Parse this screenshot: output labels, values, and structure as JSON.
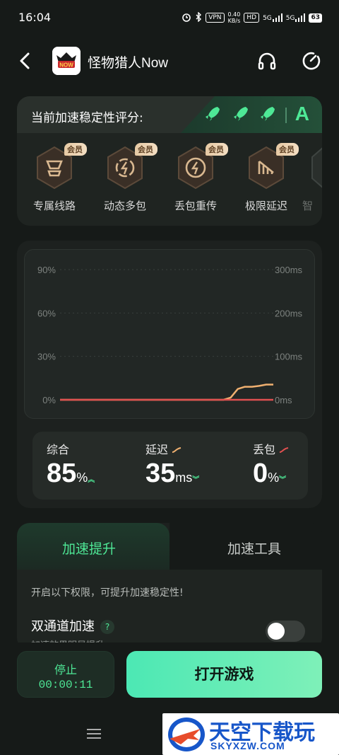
{
  "status_bar": {
    "time": "16:04",
    "vpn": "VPN",
    "speed_top": "0.40",
    "speed_bottom": "KB/s",
    "hd": "HD",
    "net1": "5G",
    "net2": "5G",
    "battery": "63"
  },
  "header": {
    "app_title": "怪物猎人Now",
    "app_icon_text": "NOW"
  },
  "stability": {
    "label": "当前加速稳定性评分:",
    "grade": "A",
    "features": [
      {
        "label": "专属线路",
        "badge": "会员"
      },
      {
        "label": "动态多包",
        "badge": "会员"
      },
      {
        "label": "丢包重传",
        "badge": "会员"
      },
      {
        "label": "极限延迟",
        "badge": "会员"
      },
      {
        "label": "智"
      }
    ]
  },
  "chart_data": {
    "type": "line",
    "left_axis_ticks": [
      "90%",
      "60%",
      "30%",
      "0%"
    ],
    "right_axis_ticks": [
      "300ms",
      "200ms",
      "100ms",
      "0ms"
    ],
    "ylim_left": [
      0,
      90
    ],
    "ylim_right": [
      0,
      300
    ],
    "grid": true,
    "series": [
      {
        "color": "#f0b070",
        "axis": "right",
        "x": [
          0,
          1,
          2,
          3,
          4,
          5,
          6,
          7,
          8,
          9,
          10,
          11,
          12,
          13,
          14,
          15,
          16,
          17,
          18,
          19,
          20,
          21,
          22,
          23,
          24,
          25,
          26,
          27,
          28,
          29,
          30
        ],
        "values": [
          0,
          0,
          0,
          0,
          0,
          0,
          0,
          0,
          0,
          0,
          0,
          0,
          0,
          0,
          0,
          0,
          0,
          0,
          0,
          0,
          0,
          0,
          0,
          0,
          5,
          25,
          30,
          30,
          32,
          35,
          35
        ]
      },
      {
        "color": "#e05050",
        "axis": "left",
        "x": [
          0,
          30
        ],
        "values": [
          0,
          0
        ]
      }
    ]
  },
  "stats": {
    "overall": {
      "name": "综合",
      "value": "85",
      "unit": "%"
    },
    "latency": {
      "name": "延迟",
      "value": "35",
      "unit": "ms"
    },
    "loss": {
      "name": "丢包",
      "value": "0",
      "unit": "%"
    }
  },
  "tabs": {
    "active": "加速提升",
    "inactive": "加速工具"
  },
  "boost": {
    "hint": "开启以下权限，可提升加速稳定性!",
    "dual_label": "双通道加速",
    "qmark": "?",
    "sub": "加速效果明显提升"
  },
  "actions": {
    "stop_label": "停止",
    "timer": "00:00:11",
    "open_game": "打开游戏"
  },
  "watermark": {
    "title": "天空下载玩",
    "url": "SKYXZW.COM"
  },
  "colors": {
    "accent": "#4ee896",
    "latency_line": "#f0b070",
    "loss_line": "#e05050",
    "button_gradient_start": "#4ce8b4"
  }
}
